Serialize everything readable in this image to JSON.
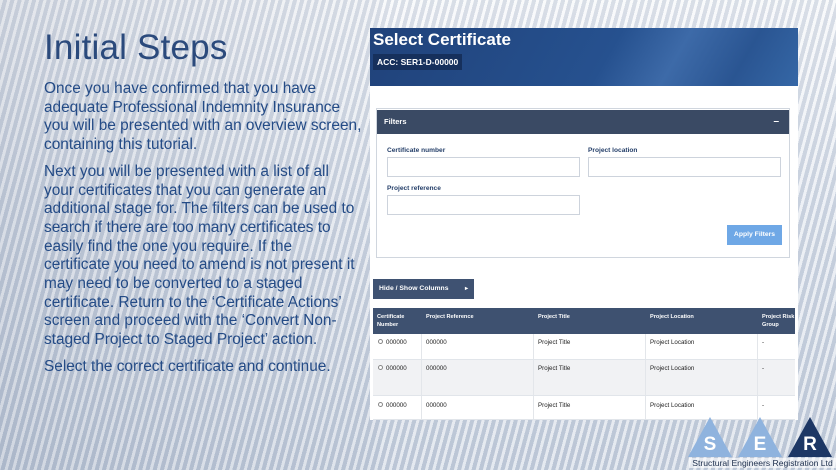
{
  "slide": {
    "title": "Initial Steps",
    "paragraphs": [
      "Once you have confirmed that you have adequate Professional Indemnity Insurance you will be presented with an overview screen, containing this tutorial.",
      "Next you will be presented with a list of all your certificates that you can generate an additional stage for. The filters can be used to search if there are too many certificates to easily find the one you require. If the certificate you need to amend is not present it may need to be converted to a staged certificate. Return to the ‘Certificate Actions’ screen and proceed with the ‘Convert Non-staged Project to Staged Project’ action.",
      "Select the correct certificate and continue."
    ]
  },
  "screenshot": {
    "title": "Select Certificate",
    "acc": "ACC: SER1-D-00000",
    "filters": {
      "heading": "Filters",
      "collapse": "–",
      "certificate_number_label": "Certificate number",
      "project_location_label": "Project location",
      "project_reference_label": "Project reference",
      "apply": "Apply Filters"
    },
    "hide_show": "Hide / Show Columns",
    "hide_show_caret": "▸",
    "columns": [
      "Certificate Number",
      "Project Reference",
      "Project Title",
      "Project Location",
      "Project Risk Group"
    ],
    "rows": [
      {
        "cert": "000000",
        "ref": "000000",
        "title": "Project Title",
        "location": "Project Location",
        "risk": "-"
      },
      {
        "cert": "000000",
        "ref": "000000",
        "title": "Project Title",
        "location": "Project Location",
        "risk": "-"
      },
      {
        "cert": "000000",
        "ref": "000000",
        "title": "Project Title",
        "location": "Project Location",
        "risk": "-"
      }
    ]
  },
  "logo": {
    "letters": [
      "S",
      "E",
      "R"
    ],
    "text": "Structural Engineers Registration Ltd"
  },
  "colors": {
    "title_blue": "#2b4a7c",
    "body_blue": "#244b86",
    "header_navy": "#20427a",
    "table_header": "#3e5170",
    "apply_button": "#6fa8e6"
  }
}
